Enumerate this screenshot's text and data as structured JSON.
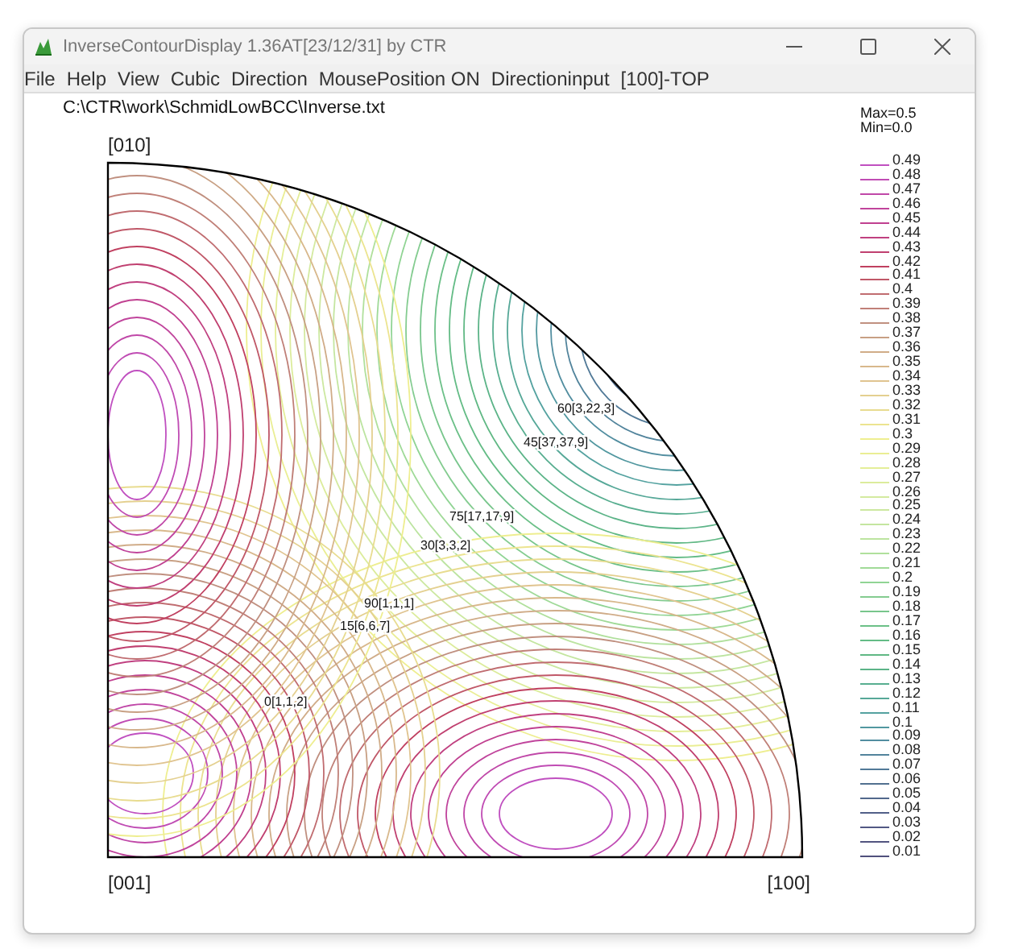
{
  "window": {
    "title": "InverseContourDisplay 1.36AT[23/12/31] by CTR"
  },
  "menu": [
    "File",
    "Help",
    "View",
    "Cubic",
    "Direction",
    "MousePosition ON",
    "Directioninput",
    "[100]-TOP"
  ],
  "file_path": "C:\\CTR\\work\\SchmidLowBCC\\Inverse.txt",
  "plot": {
    "corners": [
      "[010]",
      "[001]",
      "[100]"
    ],
    "annotations": [
      "60[3,22,3]",
      "45[37,37,9]",
      "75[17,17,9]",
      "30[3,3,2]",
      "90[1,1,1]",
      "15[6,6,7]",
      "0[1,1,2]"
    ]
  },
  "legend": {
    "max": "Max=0.5",
    "min": "Min=0.0",
    "items": [
      {
        "label": "0.49",
        "color": "#c050c0"
      },
      {
        "label": "0.48",
        "color": "#c04cb4"
      },
      {
        "label": "0.47",
        "color": "#c048a8"
      },
      {
        "label": "0.46",
        "color": "#c0449c"
      },
      {
        "label": "0.45",
        "color": "#c04090"
      },
      {
        "label": "0.44",
        "color": "#c04080"
      },
      {
        "label": "0.43",
        "color": "#c04070"
      },
      {
        "label": "0.42",
        "color": "#c04060"
      },
      {
        "label": "0.41",
        "color": "#c05868"
      },
      {
        "label": "0.4",
        "color": "#c06c70"
      },
      {
        "label": "0.39",
        "color": "#c08078"
      },
      {
        "label": "0.38",
        "color": "#c09080"
      },
      {
        "label": "0.37",
        "color": "#c8a084"
      },
      {
        "label": "0.36",
        "color": "#d0ac88"
      },
      {
        "label": "0.35",
        "color": "#d8b88c"
      },
      {
        "label": "0.34",
        "color": "#e0c490"
      },
      {
        "label": "0.33",
        "color": "#e4d090"
      },
      {
        "label": "0.32",
        "color": "#e8dc90"
      },
      {
        "label": "0.31",
        "color": "#ece490"
      },
      {
        "label": "0.3",
        "color": "#eeee90"
      },
      {
        "label": "0.29",
        "color": "#eaee94"
      },
      {
        "label": "0.28",
        "color": "#e4ee98"
      },
      {
        "label": "0.27",
        "color": "#dcec9c"
      },
      {
        "label": "0.26",
        "color": "#d4eaa0"
      },
      {
        "label": "0.25",
        "color": "#cce8a0"
      },
      {
        "label": "0.24",
        "color": "#c4e6a0"
      },
      {
        "label": "0.23",
        "color": "#bce4a0"
      },
      {
        "label": "0.22",
        "color": "#b0e09c"
      },
      {
        "label": "0.21",
        "color": "#a0da98"
      },
      {
        "label": "0.2",
        "color": "#90d494"
      },
      {
        "label": "0.19",
        "color": "#84cc90"
      },
      {
        "label": "0.18",
        "color": "#78c68c"
      },
      {
        "label": "0.17",
        "color": "#6cc088"
      },
      {
        "label": "0.16",
        "color": "#64bc86"
      },
      {
        "label": "0.15",
        "color": "#60b884"
      },
      {
        "label": "0.14",
        "color": "#5cb488"
      },
      {
        "label": "0.13",
        "color": "#58ae90"
      },
      {
        "label": "0.12",
        "color": "#56a898"
      },
      {
        "label": "0.11",
        "color": "#54a2a0"
      },
      {
        "label": "0.1",
        "color": "#5298a0"
      },
      {
        "label": "0.09",
        "color": "#528ea0"
      },
      {
        "label": "0.08",
        "color": "#52849c"
      },
      {
        "label": "0.07",
        "color": "#527a98"
      },
      {
        "label": "0.06",
        "color": "#527090"
      },
      {
        "label": "0.05",
        "color": "#52688c"
      },
      {
        "label": "0.04",
        "color": "#526088"
      },
      {
        "label": "0.03",
        "color": "#525884"
      },
      {
        "label": "0.02",
        "color": "#525480"
      },
      {
        "label": "0.01",
        "color": "#50507c"
      }
    ]
  }
}
